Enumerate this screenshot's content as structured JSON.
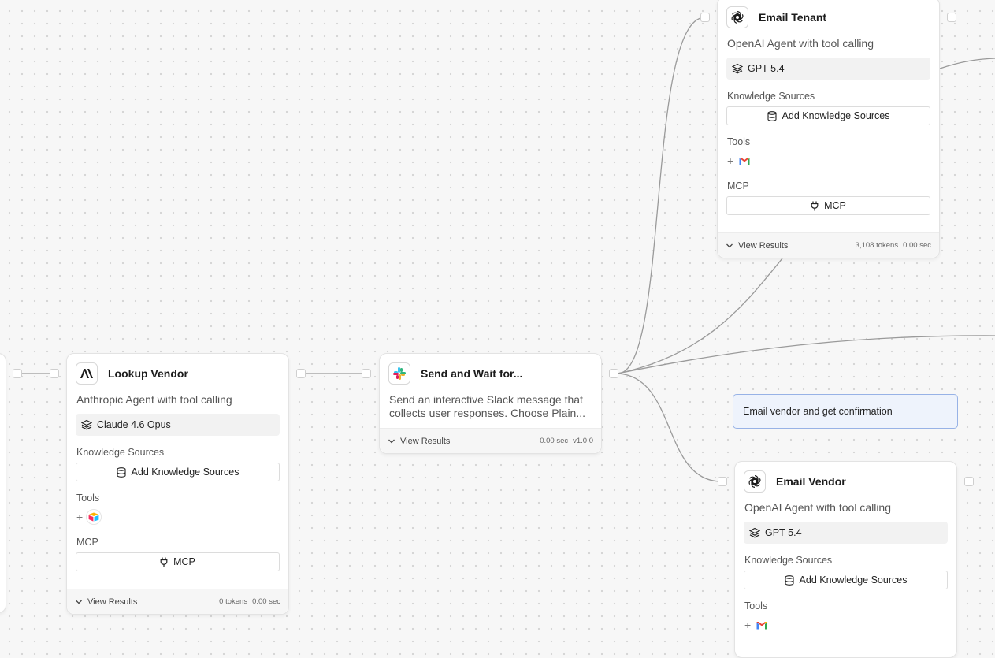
{
  "nodes": {
    "lookup_vendor": {
      "title": "Lookup Vendor",
      "icon": "anthropic-icon",
      "description": "Anthropic Agent with tool calling",
      "model": "Claude 4.6 Opus",
      "knowledge_label": "Knowledge Sources",
      "knowledge_button": "Add Knowledge Sources",
      "tools_label": "Tools",
      "tools_add": "+",
      "tool_icons": [
        "airtable-icon"
      ],
      "mcp_label": "MCP",
      "mcp_button": "MCP",
      "view_results": "View Results",
      "tokens": "0 tokens",
      "time": "0.00 sec"
    },
    "send_wait": {
      "title": "Send and Wait for...",
      "icon": "slack-icon",
      "description": "Send an interactive Slack message that collects user responses. Choose Plain...",
      "view_results": "View Results",
      "time": "0.00 sec",
      "version": "v1.0.0"
    },
    "email_tenant": {
      "title": "Email Tenant",
      "icon": "openai-icon",
      "description": "OpenAI Agent with tool calling",
      "model": "GPT-5.4",
      "knowledge_label": "Knowledge Sources",
      "knowledge_button": "Add Knowledge Sources",
      "tools_label": "Tools",
      "tools_add": "+",
      "tool_icons": [
        "gmail-icon"
      ],
      "mcp_label": "MCP",
      "mcp_button": "MCP",
      "view_results": "View Results",
      "tokens": "3,108 tokens",
      "time": "0.00 sec"
    },
    "email_vendor": {
      "title": "Email Vendor",
      "icon": "openai-icon",
      "description": "OpenAI Agent with tool calling",
      "model": "GPT-5.4",
      "knowledge_label": "Knowledge Sources",
      "knowledge_button": "Add Knowledge Sources",
      "tools_label": "Tools",
      "tools_add": "+",
      "tool_icons": [
        "gmail-icon"
      ]
    }
  },
  "note": {
    "text": "Email vendor and get confirmation"
  },
  "colors": {
    "canvas": "#f7f7f7",
    "edge": "#9a9a9a",
    "note_bg": "#eef3fc",
    "note_border": "#97b2e6"
  }
}
